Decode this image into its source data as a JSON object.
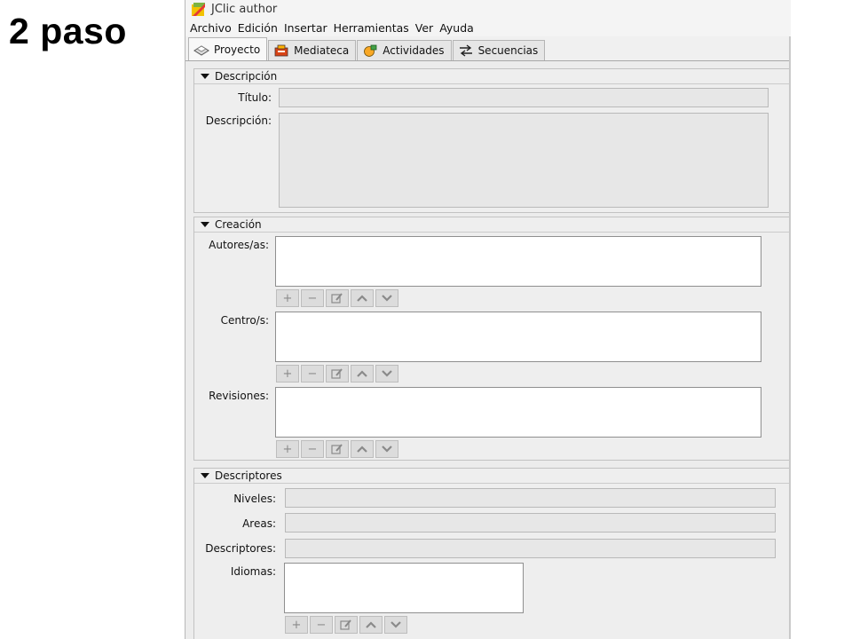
{
  "slide": {
    "title": "2 paso"
  },
  "window": {
    "title": "JClic author"
  },
  "menu": [
    "Archivo",
    "Edición",
    "Insertar",
    "Herramientas",
    "Ver",
    "Ayuda"
  ],
  "tabs": [
    {
      "label": "Proyecto",
      "icon": "project-icon",
      "active": true
    },
    {
      "label": "Mediateca",
      "icon": "media-library-icon",
      "active": false
    },
    {
      "label": "Actividades",
      "icon": "activities-icon",
      "active": false
    },
    {
      "label": "Secuencias",
      "icon": "sequences-icon",
      "active": false
    }
  ],
  "descripcion": {
    "header": "Descripción",
    "titulo_label": "Título:",
    "titulo_value": "",
    "descripcion_label": "Descripción:",
    "descripcion_value": ""
  },
  "creacion": {
    "header": "Creación",
    "autores_label": "Autores/as:",
    "centros_label": "Centro/s:",
    "revisiones_label": "Revisiones:"
  },
  "descriptores": {
    "header": "Descriptores",
    "niveles_label": "Niveles:",
    "areas_label": "Areas:",
    "descriptores_label": "Descriptores:",
    "idiomas_label": "Idiomas:"
  },
  "list_buttons": {
    "add": "+",
    "remove": "−",
    "icons": [
      "add-icon",
      "remove-icon",
      "edit-icon",
      "move-up-icon",
      "move-down-icon"
    ]
  },
  "colors": {
    "app_bg": "#ececec",
    "field_bg": "#e7e7e7",
    "disabled_icon": "#8a8a8a"
  }
}
